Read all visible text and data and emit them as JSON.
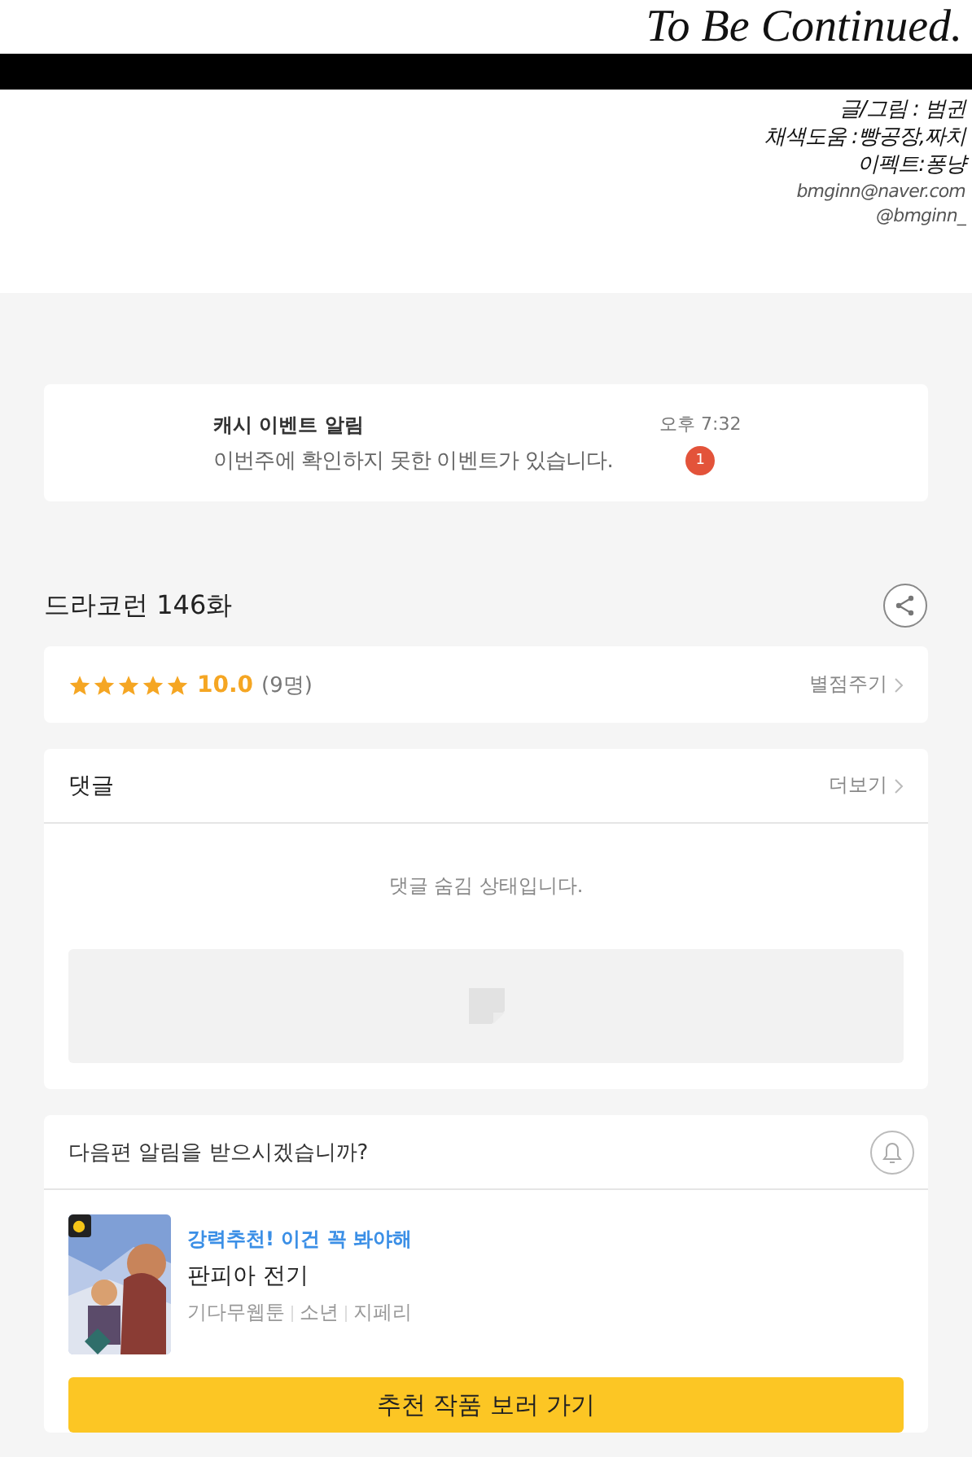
{
  "comic": {
    "ending": "To Be Continued.",
    "credits": [
      "글/그림 : 범귄",
      "채색도움 :빵공장,짜치",
      "이펙트:퐁냥"
    ],
    "contacts": [
      "bmginn@naver.com",
      "@bmginn_"
    ]
  },
  "notification": {
    "title": "캐시 이벤트 알림",
    "message": "이번주에 확인하지 못한 이벤트가 있습니다.",
    "time": "오후 7:32",
    "badge": "1"
  },
  "episode": {
    "title": "드라코런 146화"
  },
  "rating": {
    "stars": 5,
    "score": "10.0",
    "count": "(9명)",
    "action": "별점주기"
  },
  "comments": {
    "title": "댓글",
    "more": "더보기",
    "notice": "댓글 숨김 상태입니다."
  },
  "next": {
    "question": "다음편 알림을 받으시겠습니까?",
    "recommend": {
      "tagline": "강력추천! 이건 꼭 봐야해",
      "title": "판피아 전기",
      "tags": [
        "기다무웹툰",
        "소년",
        "지페리"
      ]
    },
    "button": "추천 작품 보러 가기"
  }
}
